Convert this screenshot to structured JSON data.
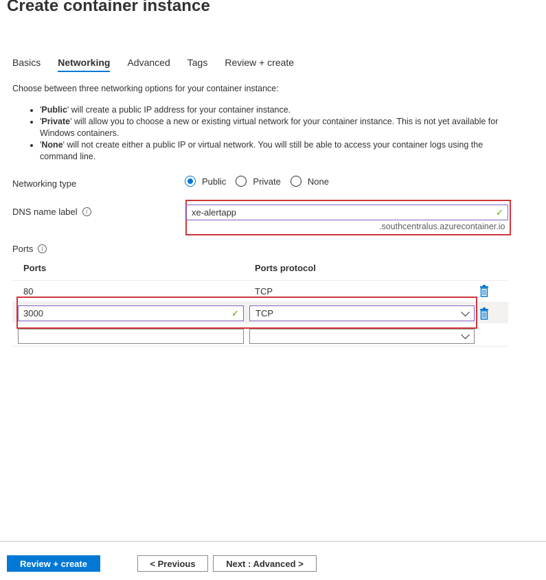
{
  "page_title": "Create container instance",
  "tabs": [
    {
      "label": "Basics"
    },
    {
      "label": "Networking"
    },
    {
      "label": "Advanced"
    },
    {
      "label": "Tags"
    },
    {
      "label": "Review + create"
    }
  ],
  "active_tab": "Networking",
  "intro": "Choose between three networking options for your container instance:",
  "bullets": [
    {
      "bold": "Public",
      "text": "' will create a public IP address for your container instance."
    },
    {
      "bold": "Private",
      "text": "' will allow you to choose a new or existing virtual network for your container instance. This is not yet available for Windows containers."
    },
    {
      "bold": "None",
      "text": "' will not create either a public IP or virtual network. You will still be able to access your container logs using the command line."
    }
  ],
  "networking_type": {
    "label": "Networking type",
    "options": [
      {
        "label": "Public",
        "selected": true
      },
      {
        "label": "Private",
        "selected": false
      },
      {
        "label": "None",
        "selected": false
      }
    ]
  },
  "dns": {
    "label": "DNS name label",
    "value": "xe-alertapp",
    "suffix": ".southcentralus.azurecontainer.io",
    "valid": true
  },
  "ports": {
    "label": "Ports",
    "columns": [
      "Ports",
      "Ports protocol"
    ],
    "rows": [
      {
        "port": "80",
        "protocol": "TCP"
      },
      {
        "port": "3000",
        "protocol": "TCP"
      },
      {
        "port": "",
        "protocol": ""
      }
    ]
  },
  "footer": {
    "review_create": "Review + create",
    "previous": "< Previous",
    "next": "Next : Advanced >"
  },
  "colors": {
    "accent": "#0078d4",
    "highlight": "#d13438",
    "valid_check": "#57a300",
    "valid_border": "#8661c5"
  },
  "icons": {
    "info": "info-icon",
    "check": "checkmark-icon",
    "delete": "trash-icon",
    "dropdown": "chevron-down-icon"
  }
}
